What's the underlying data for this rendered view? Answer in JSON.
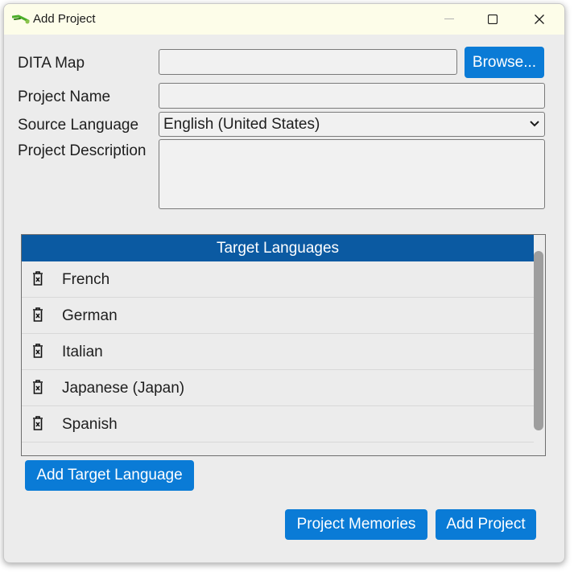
{
  "window": {
    "title": "Add Project",
    "controls": {
      "minimize": "—",
      "maximize": "☐",
      "close": "✕"
    }
  },
  "form": {
    "dita_map_label": "DITA Map",
    "dita_map_value": "",
    "browse_label": "Browse...",
    "project_name_label": "Project Name",
    "project_name_value": "",
    "source_language_label": "Source Language",
    "source_language_value": "English (United States)",
    "project_description_label": "Project Description",
    "project_description_value": ""
  },
  "target_languages": {
    "header": "Target Languages",
    "items": [
      {
        "label": "French"
      },
      {
        "label": "German"
      },
      {
        "label": "Italian"
      },
      {
        "label": "Japanese (Japan)"
      },
      {
        "label": "Spanish"
      }
    ],
    "add_label": "Add Target Language"
  },
  "footer": {
    "project_memories_label": "Project Memories",
    "add_project_label": "Add Project"
  },
  "colors": {
    "accent": "#0a7bd6",
    "header_bg": "#0b5aa2",
    "titlebar_bg": "#fdfde9",
    "window_bg": "#ececec"
  }
}
